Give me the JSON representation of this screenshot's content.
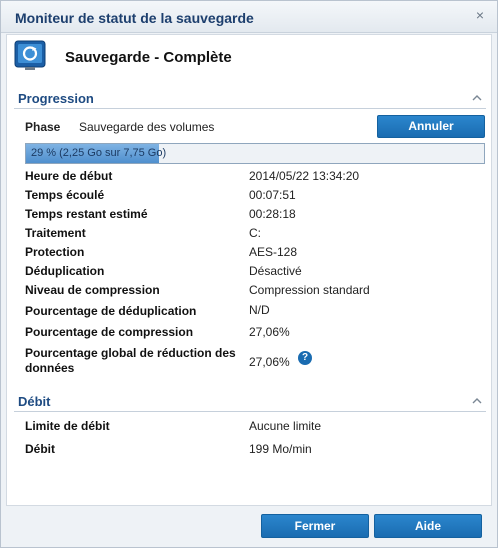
{
  "window": {
    "title": "Moniteur de statut de la sauvegarde",
    "close_glyph": "×"
  },
  "status": {
    "text": "Sauvegarde - Complète",
    "icon": "backup-monitor-icon"
  },
  "progression": {
    "section_label": "Progression",
    "phase_label": "Phase",
    "phase_value": "Sauvegarde des volumes",
    "cancel_button": "Annuler",
    "progress_text": "29 % (2,25 Go sur 7,75 Go)",
    "progress_fraction": 0.29,
    "rows": [
      {
        "label": "Heure de début",
        "value": "2014/05/22 13:34:20"
      },
      {
        "label": "Temps écoulé",
        "value": "00:07:51"
      },
      {
        "label": "Temps restant estimé",
        "value": "00:28:18"
      },
      {
        "label": "Traitement",
        "value": "C:"
      },
      {
        "label": "Protection",
        "value": "AES-128"
      },
      {
        "label": "Déduplication",
        "value": "Désactivé"
      },
      {
        "label": "Niveau de compression",
        "value": "Compression standard"
      },
      {
        "label": "Pourcentage de déduplication",
        "value": "N/D"
      },
      {
        "label": "Pourcentage de compression",
        "value": "27,06%"
      }
    ],
    "global_reduction": {
      "label_line1": "Pourcentage global de réduction des",
      "label_line2": "données",
      "value": "27,06%",
      "help_glyph": "?"
    }
  },
  "debit": {
    "section_label": "Débit",
    "rows": [
      {
        "label": "Limite de débit",
        "value": "Aucune limite"
      },
      {
        "label": "Débit",
        "value": "199 Mo/min"
      }
    ]
  },
  "footer": {
    "close_button": "Fermer",
    "help_button": "Aide"
  },
  "colors": {
    "accent": "#1a6cb1",
    "section_title": "#1e4b82",
    "window_title": "#1d3f6e"
  }
}
